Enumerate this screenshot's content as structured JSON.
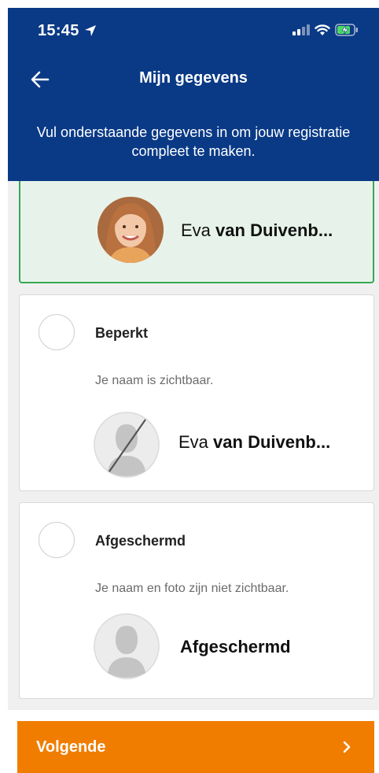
{
  "status_bar": {
    "time": "15:45"
  },
  "header": {
    "title": "Mijn gegevens",
    "subtitle": "Vul onderstaande gegevens in om jouw registratie compleet te maken."
  },
  "options": [
    {
      "first_name": "Eva",
      "last_name": "van Duivenb...",
      "selected": true
    },
    {
      "title": "Beperkt",
      "description": "Je naam is zichtbaar.",
      "first_name": "Eva",
      "last_name": "van Duivenb...",
      "selected": false
    },
    {
      "title": "Afgeschermd",
      "description": "Je naam en foto zijn niet zichtbaar.",
      "display_name": "Afgeschermd",
      "selected": false
    }
  ],
  "footer": {
    "next_label": "Volgende"
  },
  "colors": {
    "header": "#0a3a86",
    "accent": "#f07d00",
    "selected_border": "#36a853",
    "selected_bg": "#e7f3ea"
  }
}
